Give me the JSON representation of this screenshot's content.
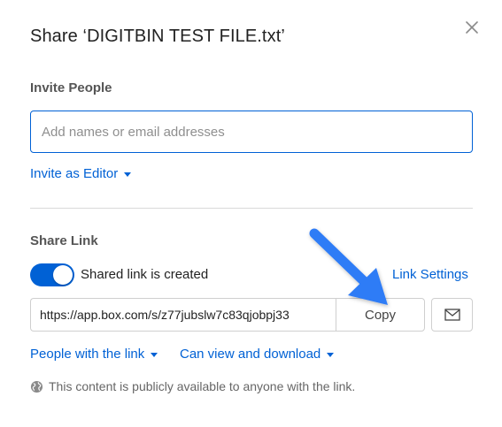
{
  "dialog": {
    "title": "Share ‘DIGITBIN TEST FILE.txt’",
    "close_icon": "close-icon"
  },
  "invite": {
    "section_label": "Invite People",
    "input_placeholder": "Add names or email addresses",
    "input_value": "",
    "role_dropdown": "Invite as Editor"
  },
  "share_link": {
    "section_label": "Share Link",
    "toggle_state": "on",
    "toggle_label": "Shared link is created",
    "settings_link": "Link Settings",
    "url": "https://app.box.com/s/z77jubslw7c83qjobpj33",
    "copy_label": "Copy",
    "email_icon": "envelope-icon",
    "access_dropdown": "People with the link",
    "permission_dropdown": "Can view and download",
    "notice": "This content is publicly available to anyone with the link.",
    "notice_icon": "globe-icon"
  },
  "colors": {
    "accent": "#0061d5",
    "annotation_arrow": "#2f7cf6"
  }
}
